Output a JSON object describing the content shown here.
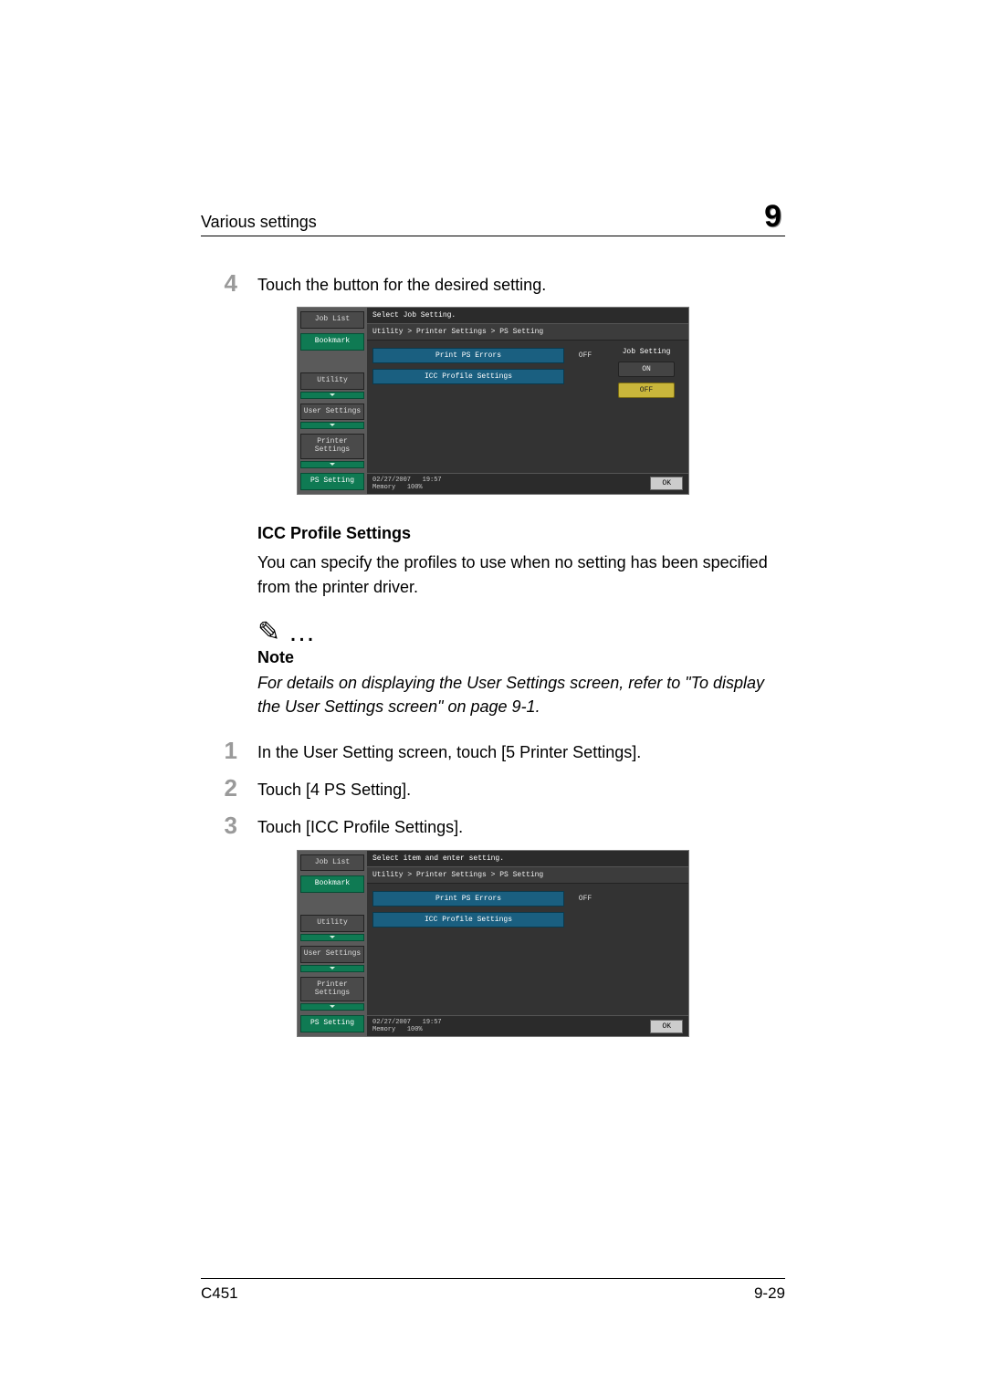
{
  "header": {
    "section_title": "Various settings",
    "chapter_number": "9"
  },
  "step4": {
    "num": "4",
    "text": "Touch the button for the desired setting."
  },
  "shot1": {
    "side": {
      "job_list": "Job List",
      "bookmark": "Bookmark",
      "utility": "Utility",
      "user_settings": "User Settings",
      "printer_settings": "Printer Settings",
      "ps_setting": "PS Setting"
    },
    "top_msg": "Select Job Setting.",
    "breadcrumb": "Utility > Printer Settings > PS Setting",
    "btn_print": "Print PS Errors",
    "val_print": "OFF",
    "btn_icc": "ICC Profile Settings",
    "right_label": "Job Setting",
    "on": "ON",
    "off": "OFF",
    "foot_date": "02/27/2007",
    "foot_time": "19:57",
    "foot_mem": "Memory",
    "foot_pct": "100%",
    "ok": "OK"
  },
  "subhead_icc": "ICC Profile Settings",
  "para_icc": "You can specify the profiles to use when no setting has been specified from the printer driver.",
  "note": {
    "icon": "✎ …",
    "label": "Note",
    "text": "For details on displaying the User Settings screen, refer to \"To display the User Settings screen\" on page 9-1."
  },
  "steps2": {
    "s1": {
      "num": "1",
      "text": "In the User Setting screen, touch [5 Printer Settings]."
    },
    "s2": {
      "num": "2",
      "text": "Touch [4 PS Setting]."
    },
    "s3": {
      "num": "3",
      "text": "Touch [ICC Profile Settings]."
    }
  },
  "shot2": {
    "side": {
      "job_list": "Job List",
      "bookmark": "Bookmark",
      "utility": "Utility",
      "user_settings": "User Settings",
      "printer_settings": "Printer Settings",
      "ps_setting": "PS Setting"
    },
    "top_msg": "Select item and enter setting.",
    "breadcrumb": "Utility > Printer Settings > PS Setting",
    "btn_print": "Print PS Errors",
    "val_print": "OFF",
    "btn_icc": "ICC Profile Settings",
    "foot_date": "02/27/2007",
    "foot_time": "19:57",
    "foot_mem": "Memory",
    "foot_pct": "100%",
    "ok": "OK"
  },
  "footer": {
    "model": "C451",
    "page": "9-29"
  }
}
